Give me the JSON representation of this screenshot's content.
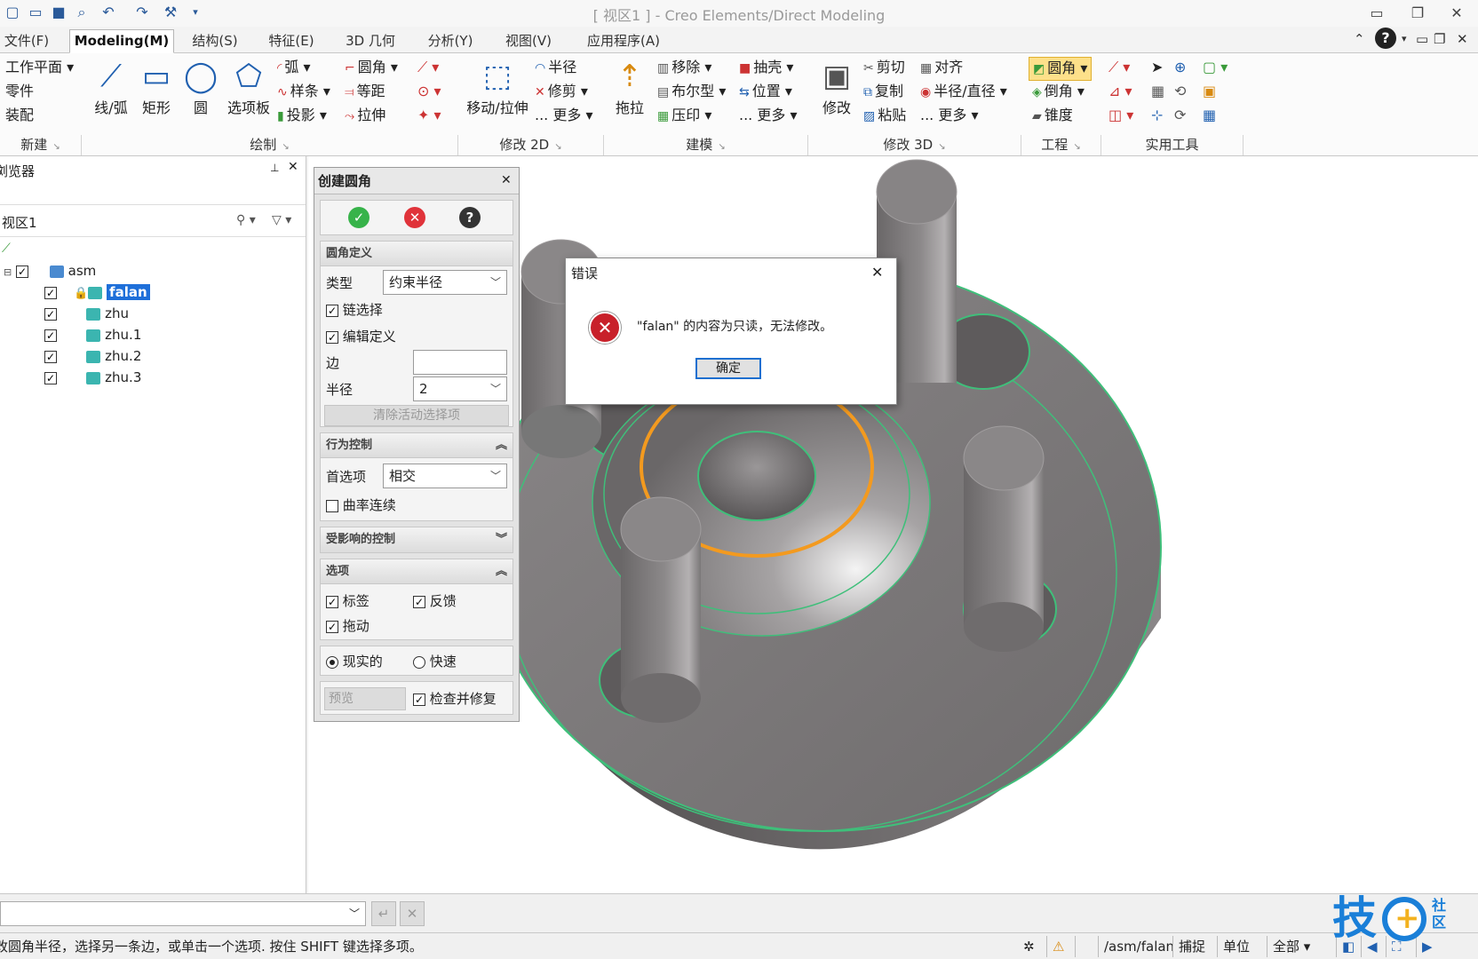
{
  "app": {
    "window_title": "[ 视区1 ] - Creo Elements/Direct Modeling"
  },
  "tabs": [
    {
      "label": "文件(F)"
    },
    {
      "label": "Modeling(M)"
    },
    {
      "label": "结构(S)"
    },
    {
      "label": "特征(E)"
    },
    {
      "label": "3D 几何"
    },
    {
      "label": "分析(Y)"
    },
    {
      "label": "视图(V)"
    },
    {
      "label": "应用程序(A)"
    }
  ],
  "ribbon": {
    "new": {
      "items": [
        "工作平面",
        "零件",
        "装配"
      ],
      "group": "新建"
    },
    "draw": {
      "line": "线/弧",
      "rect": "矩形",
      "circle": "圆",
      "polygon": "选项板",
      "arc": "弧",
      "spline": "样条",
      "project": "投影",
      "fillet": "圆角",
      "offset": "等距",
      "stretch": "拉伸",
      "group": "绘制"
    },
    "modify2d": {
      "move": "移动/拉伸",
      "radius": "半径",
      "trim": "修剪",
      "more": "更多",
      "group": "修改 2D"
    },
    "build": {
      "pull": "拖拉",
      "remove": "移除",
      "boolean": "布尔型",
      "imprint": "压印",
      "shell": "抽壳",
      "position": "位置",
      "more": "更多",
      "group": "建模"
    },
    "modify3d": {
      "modify": "修改",
      "cut": "剪切",
      "copy": "复制",
      "paste": "粘贴",
      "align": "对齐",
      "radius_dia": "半径/直径",
      "more": "更多",
      "group": "修改 3D"
    },
    "engineering": {
      "fillet": "圆角",
      "chamfer": "倒角",
      "taper": "锥度",
      "group": "工程"
    },
    "utilities": {
      "group": "实用工具"
    }
  },
  "browser": {
    "title": "浏览器",
    "viewport": "视区1",
    "tree": [
      {
        "label": "asm"
      },
      {
        "label": "falan"
      },
      {
        "label": "zhu"
      },
      {
        "label": "zhu.1"
      },
      {
        "label": "zhu.2"
      },
      {
        "label": "zhu.3"
      }
    ]
  },
  "panel": {
    "title": "创建圆角",
    "def": {
      "header": "圆角定义",
      "type_label": "类型",
      "type_value": "约束半径",
      "chain": "链选择",
      "edit_def": "编辑定义",
      "edge_label": "边",
      "radius_label": "半径",
      "radius_value": "2",
      "clear": "清除活动选择项"
    },
    "behavior": {
      "header": "行为控制",
      "pref_label": "首选项",
      "pref_value": "相交",
      "curvature": "曲率连续"
    },
    "affected": {
      "header": "受影响的控制"
    },
    "options": {
      "header": "选项",
      "tag": "标签",
      "feedback": "反馈",
      "drag": "拖动"
    },
    "mode": {
      "realistic": "现实的",
      "fast": "快速"
    },
    "preview": "预览",
    "check_fix": "检查并修复"
  },
  "error": {
    "title": "错误",
    "message": "\"falan\" 的内容为只读，无法修改。",
    "ok": "确定"
  },
  "status": {
    "prompt": "改圆角半径，选择另一条边，或单击一个选项. 按住 SHIFT 键选择多项。",
    "path": "/asm/falan",
    "snap": "捕捉",
    "units": "单位",
    "filter": "全部"
  },
  "watermark": {
    "text": "技",
    "sub": "社区"
  },
  "colors": {
    "accent": "#2a5a9a",
    "selection": "#1e6fd9",
    "highlight_ring": "#f39a1f",
    "edge": "#3fbf7a",
    "error": "#c8202a"
  }
}
